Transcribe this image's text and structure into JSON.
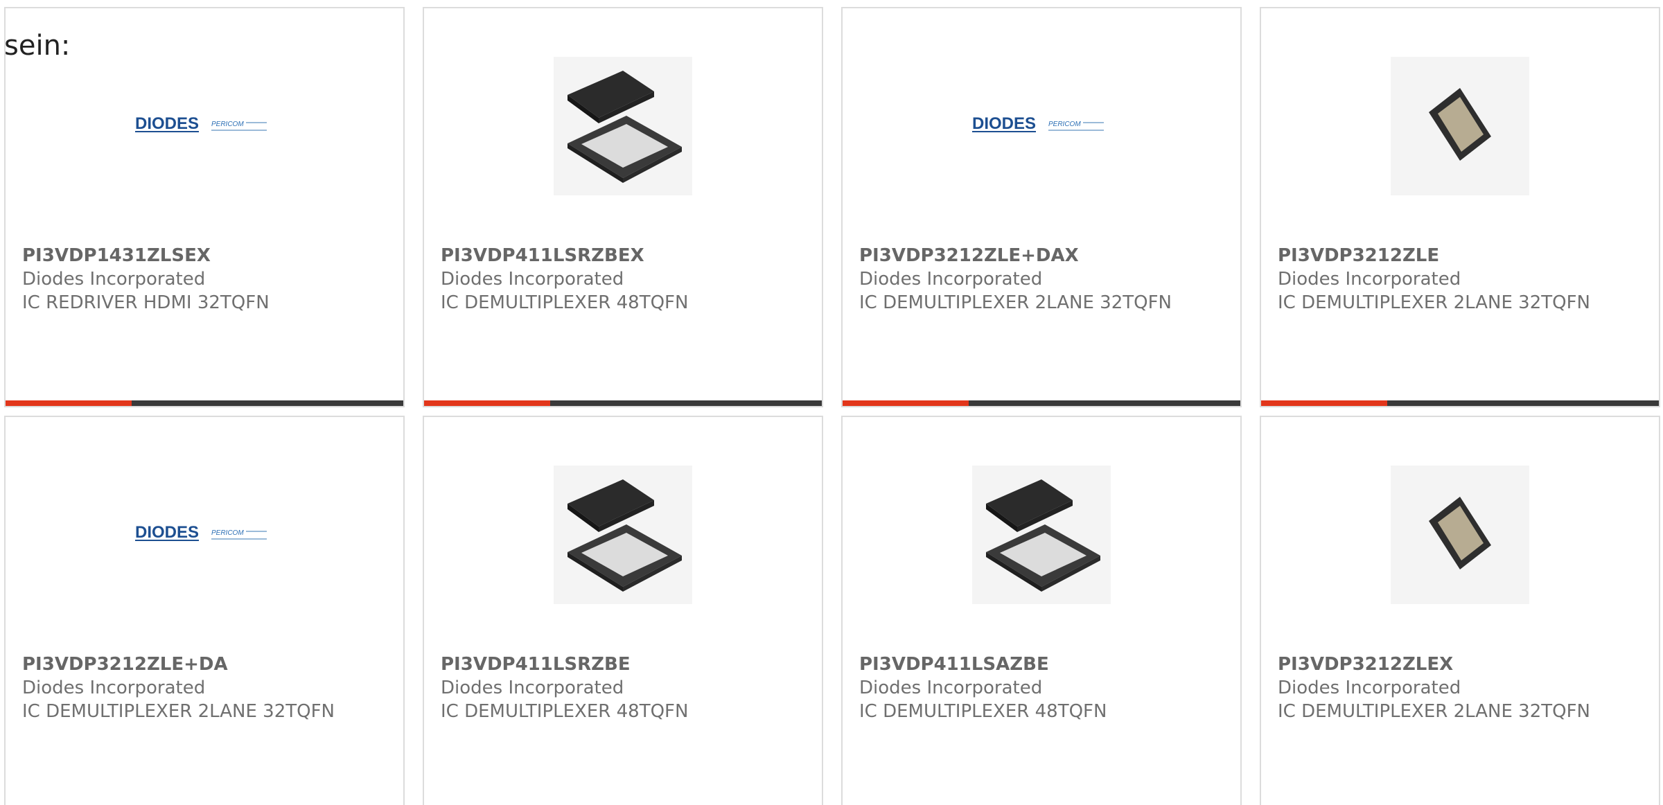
{
  "intro_text": "sein:",
  "colors": {
    "accent": "#e2361b",
    "bar": "#3a3a3a",
    "border": "#dcdcdc",
    "text": "#666666"
  },
  "products": [
    {
      "part_number": "PI3VDP1431ZLSEX",
      "manufacturer": "Diodes Incorporated",
      "description": "IC REDRIVER HDMI 32TQFN",
      "image": "diodes-pericom-logo"
    },
    {
      "part_number": "PI3VDP411LSRZBEX",
      "manufacturer": "Diodes Incorporated",
      "description": "IC DEMULTIPLEXER 48TQFN",
      "image": "qfn48-package-chip"
    },
    {
      "part_number": "PI3VDP3212ZLE+DAX",
      "manufacturer": "Diodes Incorporated",
      "description": "IC DEMULTIPLEXER 2LANE 32TQFN",
      "image": "diodes-pericom-logo"
    },
    {
      "part_number": "PI3VDP3212ZLE",
      "manufacturer": "Diodes Incorporated",
      "description": "IC DEMULTIPLEXER 2LANE 32TQFN",
      "image": "tqfn32-package-chip"
    },
    {
      "part_number": "PI3VDP3212ZLE+DA",
      "manufacturer": "Diodes Incorporated",
      "description": "IC DEMULTIPLEXER 2LANE 32TQFN",
      "image": "diodes-pericom-logo"
    },
    {
      "part_number": "PI3VDP411LSRZBE",
      "manufacturer": "Diodes Incorporated",
      "description": "IC DEMULTIPLEXER 48TQFN",
      "image": "qfn48-package-chip"
    },
    {
      "part_number": "PI3VDP411LSAZBE",
      "manufacturer": "Diodes Incorporated",
      "description": "IC DEMULTIPLEXER 48TQFN",
      "image": "qfn48-package-chip"
    },
    {
      "part_number": "PI3VDP3212ZLEX",
      "manufacturer": "Diodes Incorporated",
      "description": "IC DEMULTIPLEXER 2LANE 32TQFN",
      "image": "tqfn32-package-chip"
    }
  ]
}
